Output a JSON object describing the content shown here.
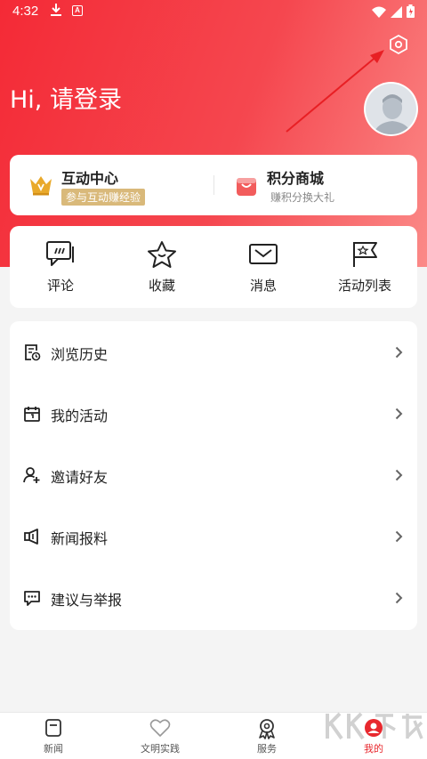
{
  "status_bar": {
    "time": "4:32"
  },
  "header": {
    "greeting": "Hi, 请登录"
  },
  "colors": {
    "accent": "#e8282e",
    "gold": "#d9b97a",
    "header_start": "#f42a36",
    "header_end": "#fb8a88"
  },
  "features": [
    {
      "title": "互动中心",
      "subtitle": "参与互动赚经验",
      "icon": "crown-icon"
    },
    {
      "title": "积分商城",
      "subtitle": "赚积分换大礼",
      "icon": "shopping-bag-icon"
    }
  ],
  "quick_actions": [
    {
      "label": "评论",
      "icon": "comment-icon"
    },
    {
      "label": "收藏",
      "icon": "star-icon"
    },
    {
      "label": "消息",
      "icon": "mail-icon"
    },
    {
      "label": "活动列表",
      "icon": "flag-icon"
    }
  ],
  "menu": [
    {
      "label": "浏览历史",
      "icon": "history-icon"
    },
    {
      "label": "我的活动",
      "icon": "calendar-icon"
    },
    {
      "label": "邀请好友",
      "icon": "add-user-icon"
    },
    {
      "label": "新闻报料",
      "icon": "megaphone-icon"
    },
    {
      "label": "建议与举报",
      "icon": "feedback-icon"
    }
  ],
  "tabs": [
    {
      "label": "新闻",
      "icon": "news-icon",
      "active": false
    },
    {
      "label": "文明实践",
      "icon": "heart-icon",
      "active": false
    },
    {
      "label": "服务",
      "icon": "service-icon",
      "active": false
    },
    {
      "label": "我的",
      "icon": "profile-icon",
      "active": true
    }
  ],
  "watermark": {
    "text": "KK下载"
  }
}
